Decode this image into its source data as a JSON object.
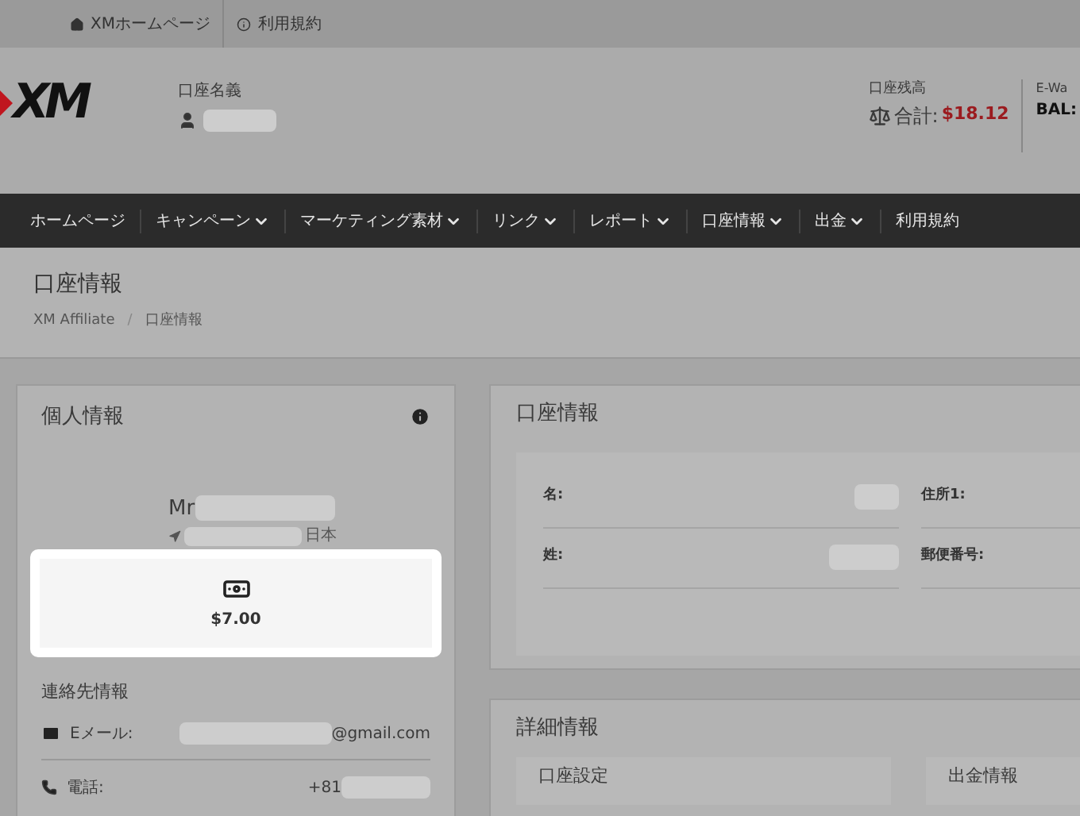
{
  "top_links": [
    {
      "kind": "home",
      "label": "XMホームページ"
    },
    {
      "kind": "info",
      "label": "利用規約"
    }
  ],
  "header": {
    "logo": "XM",
    "account_name_label": "口座名義",
    "balance_label": "口座残高",
    "total_label": "合計:",
    "total": "$18.12",
    "ewallet_label": "E-Wa",
    "bal_label": "BAL:"
  },
  "nav": [
    {
      "label": "ホームページ",
      "dropdown": false
    },
    {
      "label": "キャンペーン",
      "dropdown": true
    },
    {
      "label": "マーケティング素材",
      "dropdown": true
    },
    {
      "label": "リンク",
      "dropdown": true
    },
    {
      "label": "レポート",
      "dropdown": true
    },
    {
      "label": "口座情報",
      "dropdown": true
    },
    {
      "label": "出金",
      "dropdown": true
    },
    {
      "label": "利用規約",
      "dropdown": false
    }
  ],
  "page": {
    "title": "口座情報",
    "breadcrumb": [
      "XM Affiliate",
      "口座情報"
    ],
    "breadcrumb_separator": "/"
  },
  "personal": {
    "title": "個人情報",
    "name_prefix": "Mr",
    "country": "日本",
    "amount": "$7.00",
    "contact_title": "連絡先情報",
    "contacts": [
      {
        "kind": "email",
        "label": "Eメール:",
        "value": "@gmail.com"
      },
      {
        "kind": "phone",
        "label": "電話:",
        "value": "+81"
      }
    ]
  },
  "account": {
    "title": "口座情報",
    "fields": [
      {
        "label": "名:"
      },
      {
        "label": "住所1:"
      },
      {
        "label": "姓:"
      },
      {
        "label": "郵便番号:"
      }
    ]
  },
  "details": {
    "title": "詳細情報",
    "subpanels": [
      "口座設定",
      "出金情報"
    ]
  }
}
